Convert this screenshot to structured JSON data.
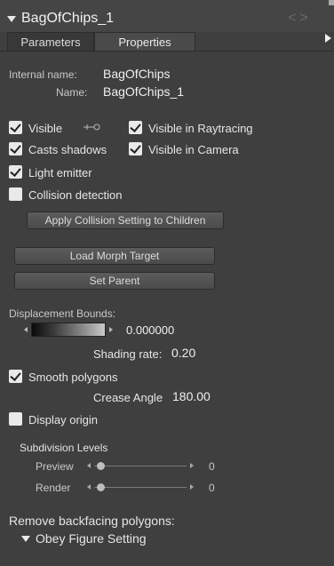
{
  "header": {
    "title": "BagOfChips_1",
    "nav_arrows": "<>"
  },
  "tabs": [
    {
      "label": "Parameters"
    },
    {
      "label": "Properties",
      "active": true
    }
  ],
  "names": {
    "internal_label": "Internal name:",
    "internal_value": "BagOfChips",
    "name_label": "Name:",
    "name_value": "BagOfChips_1"
  },
  "checkboxes": {
    "visible": {
      "label": "Visible",
      "checked": true
    },
    "visible_raytracing": {
      "label": "Visible in Raytracing",
      "checked": true
    },
    "casts_shadows": {
      "label": "Casts shadows",
      "checked": true
    },
    "visible_camera": {
      "label": "Visible in Camera",
      "checked": true
    },
    "light_emitter": {
      "label": "Light emitter",
      "checked": true
    },
    "collision_detection": {
      "label": "Collision detection",
      "checked": false
    },
    "smooth_polygons": {
      "label": "Smooth polygons",
      "checked": true
    },
    "display_origin": {
      "label": "Display origin",
      "checked": false
    }
  },
  "buttons": {
    "apply_collision": "Apply Collision Setting to Children",
    "load_morph": "Load Morph Target",
    "set_parent": "Set Parent"
  },
  "displacement": {
    "label": "Displacement Bounds:",
    "value": "0.000000"
  },
  "shading": {
    "label": "Shading rate:",
    "value": "0.20"
  },
  "crease": {
    "label": "Crease Angle",
    "value": "180.00"
  },
  "subdivision": {
    "title": "Subdivision Levels",
    "preview": {
      "label": "Preview",
      "value": "0"
    },
    "render": {
      "label": "Render",
      "value": "0"
    }
  },
  "backfacing": {
    "label": "Remove backfacing polygons:",
    "option": "Obey Figure Setting"
  }
}
